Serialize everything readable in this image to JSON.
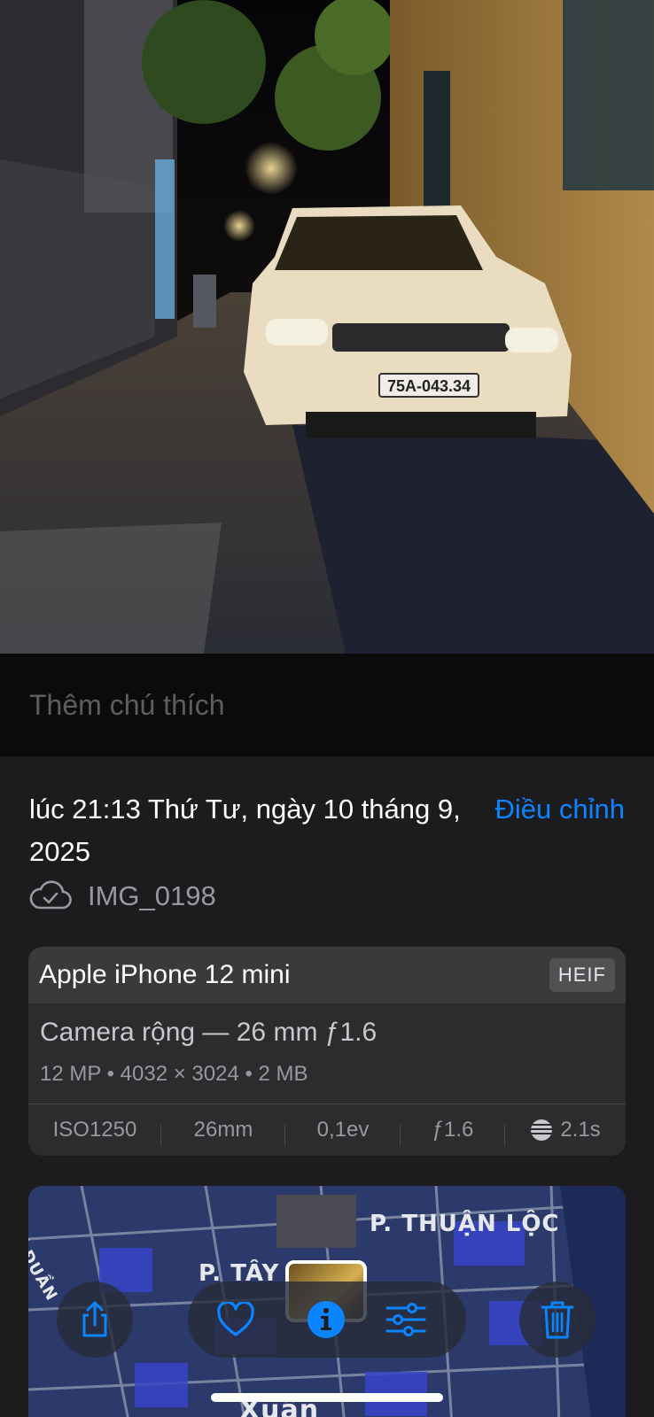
{
  "photo": {
    "plate_text": "75A-043.34"
  },
  "caption": {
    "placeholder": "Thêm chú thích"
  },
  "info": {
    "datetime": "lúc 21:13 Thứ Tư, ngày 10 tháng 9, 2025",
    "adjust_label": "Điều chỉnh",
    "file_name": "IMG_0198",
    "file_status_icon": "cloud-check-icon"
  },
  "camera": {
    "device": "Apple iPhone 12 mini",
    "format": "HEIF",
    "lens": "Camera rộng — 26 mm ƒ1.6",
    "specs": "12 MP • 4032 × 3024 • 2 MB",
    "exif": {
      "iso": "ISO1250",
      "focal_length": "26mm",
      "exposure": "0,1ev",
      "aperture": "ƒ1.6",
      "shutter": "2.1s"
    }
  },
  "map": {
    "labels": [
      "P. THUẬN LỘC",
      "P. TÂY L",
      "Ĩ ĐUẦN",
      "Xuân"
    ]
  },
  "toolbar": {
    "share_icon": "share-icon",
    "favorite_icon": "heart-icon",
    "info_icon": "info-icon",
    "edit_icon": "sliders-icon",
    "delete_icon": "trash-icon"
  },
  "colors": {
    "accent": "#0a84ff",
    "panel": "#1c1c1e",
    "card": "#2c2c2e"
  }
}
